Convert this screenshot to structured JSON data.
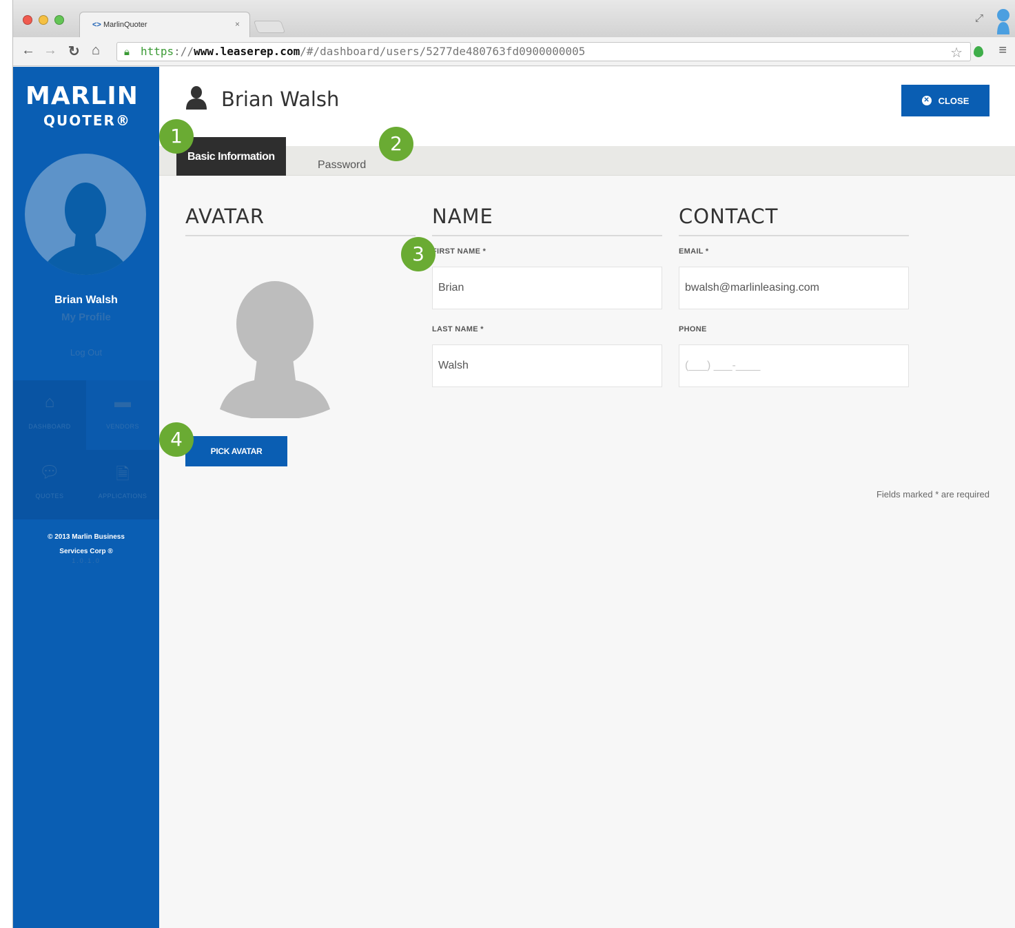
{
  "browser": {
    "tab_title": "MarlinQuoter",
    "tab_close": "×",
    "url_scheme": "https",
    "url_sep": "://",
    "url_domain": "www.leaserep.com",
    "url_path": "/#/dashboard/users/5277de480763fd0900000005"
  },
  "sidebar": {
    "brand": "MARLIN",
    "brand_sub": "QUOTER®",
    "user_name": "Brian Walsh",
    "profile_link": "My Profile",
    "logout_link": "Log Out",
    "nav": [
      {
        "label": "DASHBOARD",
        "icon": "home-icon"
      },
      {
        "label": "VENDORS",
        "icon": "briefcase-icon"
      },
      {
        "label": "QUOTES",
        "icon": "chat-icon"
      },
      {
        "label": "APPLICATIONS",
        "icon": "document-icon"
      }
    ],
    "copyright_line1": "© 2013 Marlin Business",
    "copyright_line2": "Services Corp ®",
    "version": "1.0.1.0"
  },
  "header": {
    "title": "Brian Walsh",
    "close_label": "CLOSE"
  },
  "tabs": {
    "basic": "Basic Information",
    "password": "Password"
  },
  "sections": {
    "avatar": "AVATAR",
    "name": "NAME",
    "contact": "CONTACT"
  },
  "form": {
    "first_name_label": "FIRST NAME *",
    "first_name_value": "Brian",
    "last_name_label": "LAST NAME *",
    "last_name_value": "Walsh",
    "email_label": "EMAIL *",
    "email_value": "bwalsh@marlinleasing.com",
    "phone_label": "PHONE",
    "phone_placeholder": "(___) ___-____"
  },
  "pick_avatar_label": "PICK AVATAR",
  "required_note": "Fields marked * are required",
  "callouts": [
    "1",
    "2",
    "3",
    "4"
  ],
  "colors": {
    "brand_blue": "#0a5eb3",
    "callout_green": "#6aab33",
    "active_tab": "#2e2e2e"
  }
}
